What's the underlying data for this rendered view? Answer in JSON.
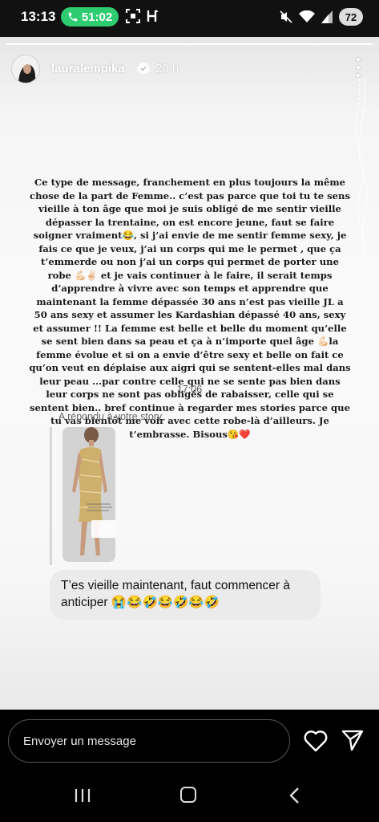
{
  "status_bar": {
    "time": "13:13",
    "call_timer": "51:02",
    "battery": "72",
    "call_color": "#2ecc71"
  },
  "story": {
    "username": "lauralempika",
    "age": "20 h",
    "verified": true,
    "caption": "Ce type de message, franchement en plus toujours la même chose de la part de Femme.. c’est pas parce que toi tu te sens vieille à ton âge que moi je suis obligé de me sentir vieille dépasser la trentaine, on est encore jeune, faut se faire soigner vraiment😂, si j’ai envie de me sentir femme sexy, je fais ce que je veux, j’ai un corps qui me le permet , que ça t’emmerde ou non j’ai un corps qui permet de porter une robe 💪🏻✌🏻 et je vais continuer à le faire, il serait temps d’apprendre à vivre avec son temps et apprendre que maintenant la femme dépassée 30 ans n’est pas vieille JL a 50 ans sexy et assumer les Kardashian dépassé 40 ans, sexy et assumer !! La femme est belle et belle du moment qu’elle se sent bien dans sa peau et ça à n’importe quel âge 💪🏻la femme évolue et si on a envie d’être sexy et belle on fait ce qu’on veut en déplaise aux aigri qui se sentent-elles mal dans leur peau ...par  contre celle qui ne se sente pas bien dans leur corps ne sont pas obligés de rabaisser, celle qui se sentent bien.. bref continue à regarder mes stories parce que tu vas bientôt me voir avec cette robe-là d’ailleurs. Je t’embrasse. Bisous😘❤️",
    "dm_time": "17:06",
    "replied_label": "A répondu à votre story",
    "reply_text": "T’es vieille maintenant, faut commencer à anticiper 😭😂🤣😂🤣😂🤣"
  },
  "bottom_bar": {
    "message_placeholder": "Envoyer un message",
    "icons": [
      "heart-icon",
      "send-icon"
    ]
  },
  "nav_bar": {
    "icons": [
      "recents-icon",
      "home-icon",
      "back-icon"
    ]
  }
}
